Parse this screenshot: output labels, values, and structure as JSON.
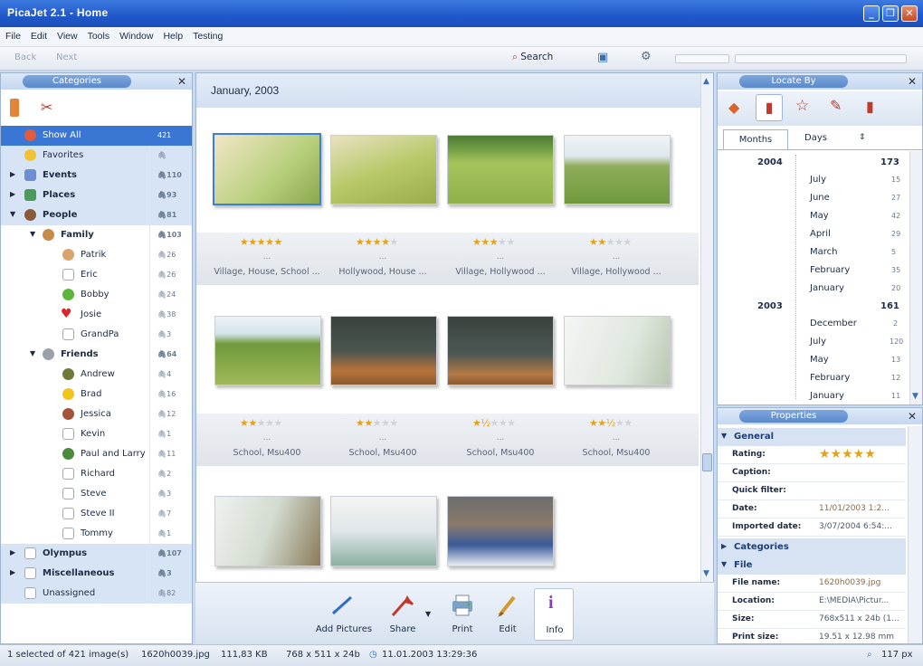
{
  "window": {
    "title": "PicaJet 2.1 - Home"
  },
  "menu": [
    "File",
    "Edit",
    "View",
    "Tools",
    "Window",
    "Help",
    "Testing"
  ],
  "toolbar": {
    "back": "Back",
    "next": "Next",
    "search": "Search"
  },
  "categories": {
    "title": "Categories",
    "items": [
      {
        "label": "Show All",
        "count": "421"
      },
      {
        "label": "Favorites",
        "count": ""
      },
      {
        "label": "Events",
        "count": "110"
      },
      {
        "label": "Places",
        "count": "93"
      },
      {
        "label": "People",
        "count": "81"
      },
      {
        "label": "Family",
        "count": "103"
      },
      {
        "label": "Patrik",
        "count": "26"
      },
      {
        "label": "Eric",
        "count": "26"
      },
      {
        "label": "Bobby",
        "count": "24"
      },
      {
        "label": "Josie",
        "count": "38"
      },
      {
        "label": "GrandPa",
        "count": "3"
      },
      {
        "label": "Friends",
        "count": "64"
      },
      {
        "label": "Andrew",
        "count": "4"
      },
      {
        "label": "Brad",
        "count": "16"
      },
      {
        "label": "Jessica",
        "count": "12"
      },
      {
        "label": "Kevin",
        "count": "1"
      },
      {
        "label": "Paul and Larry",
        "count": "11"
      },
      {
        "label": "Richard",
        "count": "2"
      },
      {
        "label": "Steve",
        "count": "3"
      },
      {
        "label": "Steve II",
        "count": "7"
      },
      {
        "label": "Tommy",
        "count": "1"
      },
      {
        "label": "Olympus",
        "count": "107"
      },
      {
        "label": "Miscellaneous",
        "count": "3"
      },
      {
        "label": "Unassigned",
        "count": "82"
      }
    ]
  },
  "gallery": {
    "heading": "January, 2003",
    "row1": [
      {
        "stars": 5,
        "dots": "...",
        "caption": "Village, House, School ..."
      },
      {
        "stars": 4,
        "dots": "...",
        "caption": "Hollywood, House ..."
      },
      {
        "stars": 3,
        "dots": "...",
        "caption": "Village, Hollywood ..."
      },
      {
        "stars": 2,
        "dots": "...",
        "caption": "Village, Hollywood ..."
      }
    ],
    "row2": [
      {
        "stars": 2,
        "dots": "...",
        "caption": "School, Msu400"
      },
      {
        "stars": 2,
        "dots": "...",
        "caption": "School, Msu400"
      },
      {
        "stars": 1.5,
        "dots": "...",
        "caption": "School, Msu400"
      },
      {
        "stars": 2.5,
        "dots": "...",
        "caption": "School, Msu400"
      }
    ]
  },
  "bottom_toolbar": {
    "add": "Add Pictures",
    "share": "Share",
    "print": "Print",
    "edit": "Edit",
    "info": "Info"
  },
  "locate": {
    "title": "Locate By",
    "tab_months": "Months",
    "tab_days": "Days",
    "years": [
      {
        "year": "2004",
        "total": "173",
        "months": [
          {
            "m": "July",
            "c": "15"
          },
          {
            "m": "June",
            "c": "27"
          },
          {
            "m": "May",
            "c": "42"
          },
          {
            "m": "April",
            "c": "29"
          },
          {
            "m": "March",
            "c": "5"
          },
          {
            "m": "February",
            "c": "35"
          },
          {
            "m": "January",
            "c": "20"
          }
        ]
      },
      {
        "year": "2003",
        "total": "161",
        "months": [
          {
            "m": "December",
            "c": "2"
          },
          {
            "m": "July",
            "c": "120"
          },
          {
            "m": "May",
            "c": "13"
          },
          {
            "m": "February",
            "c": "12"
          },
          {
            "m": "January",
            "c": "11"
          }
        ]
      }
    ]
  },
  "properties": {
    "title": "Properties",
    "general": "General",
    "rows": [
      {
        "k": "Rating:",
        "v": ""
      },
      {
        "k": "Caption:",
        "v": ""
      },
      {
        "k": "Quick filter:",
        "v": ""
      },
      {
        "k": "Date:",
        "v": "11/01/2003 1:2..."
      },
      {
        "k": "Imported date:",
        "v": "3/07/2004 6:54:..."
      }
    ],
    "categories_grp": "Categories",
    "file_grp": "File",
    "file_rows": [
      {
        "k": "File name:",
        "v": "1620h0039.jpg"
      },
      {
        "k": "Location:",
        "v": "E:\\MEDIA\\Pictur..."
      },
      {
        "k": "Size:",
        "v": "768x511 x 24b (1..."
      },
      {
        "k": "Print size:",
        "v": "19.51 x 12.98 mm"
      }
    ],
    "rating": 5
  },
  "status": {
    "selected": "1 selected of 421 image(s)",
    "file": "1620h0039.jpg",
    "size": "111,83 KB",
    "dims": "768 x 511 x 24b",
    "date": "11.01.2003 13:29:36",
    "zoom": "117 px"
  },
  "colors": {
    "accent": "#3a77d4",
    "star": "#e3a21a"
  }
}
